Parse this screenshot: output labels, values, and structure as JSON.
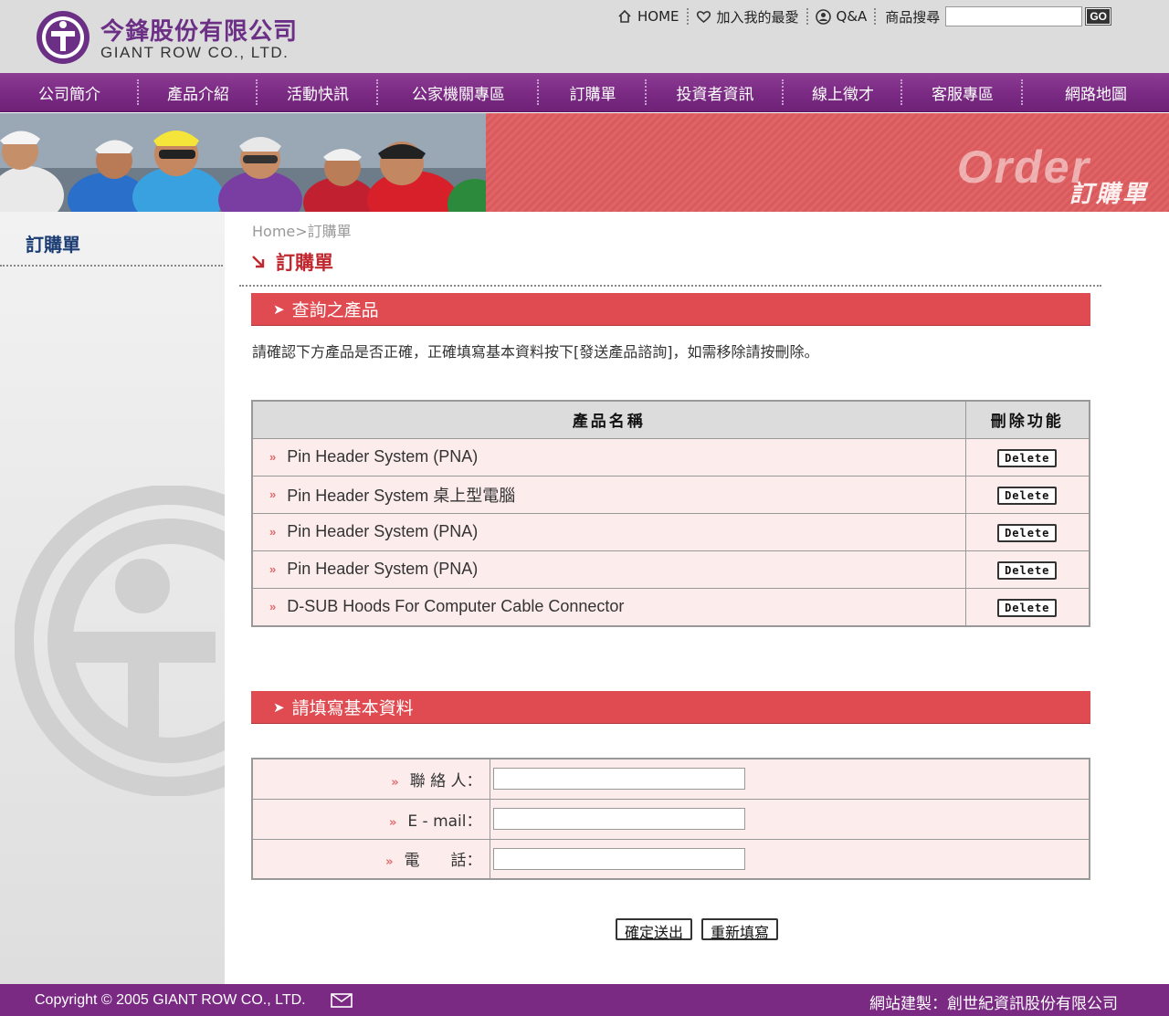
{
  "header": {
    "company_cn": "今鋒股份有限公司",
    "company_en": "GIANT ROW CO., LTD.",
    "links": {
      "home": "HOME",
      "favorite": "加入我的最愛",
      "qa": "Q&A"
    },
    "search": {
      "label": "商品搜尋",
      "value": "",
      "go": "GO"
    }
  },
  "nav": {
    "items": [
      {
        "label": "公司簡介"
      },
      {
        "label": "產品介紹"
      },
      {
        "label": "活動快訊"
      },
      {
        "label": "公家機關專區"
      },
      {
        "label": "訂購單"
      },
      {
        "label": "投資者資訊"
      },
      {
        "label": "線上徵才"
      },
      {
        "label": "客服專區"
      },
      {
        "label": "網路地圖"
      }
    ]
  },
  "banner": {
    "en": "Order",
    "cn": "訂購單"
  },
  "sidebar": {
    "title": "訂購單"
  },
  "main": {
    "breadcrumb": "Home>訂購單",
    "title": "訂購單",
    "products_section": "查詢之產品",
    "instruction": "請確認下方產品是否正確，正確填寫基本資料按下[發送產品諮詢]，如需移除請按刪除。",
    "table": {
      "col_name": "產品名稱",
      "col_delete": "刪除功能",
      "delete_label": "Delete",
      "rows": [
        {
          "name": "Pin Header System (PNA)"
        },
        {
          "name": "Pin Header System 桌上型電腦"
        },
        {
          "name": "Pin Header System (PNA)"
        },
        {
          "name": "Pin Header System (PNA)"
        },
        {
          "name": "D-SUB Hoods For Computer Cable Connector"
        }
      ]
    },
    "form_section": "請填寫基本資料",
    "form": {
      "fields": [
        {
          "label": "聯 絡 人：",
          "value": ""
        },
        {
          "label": "E - mail：",
          "value": ""
        },
        {
          "label": "電　　話：",
          "value": ""
        }
      ],
      "submit": "確定送出",
      "reset": "重新填寫"
    }
  },
  "footer": {
    "copyright": "Copyright © 2005 GIANT ROW CO., LTD.",
    "builder": "網站建製：創世紀資訊股份有限公司"
  },
  "colors": {
    "purple": "#7a2a83",
    "red": "#df4b50",
    "pink_row": "#fdecec"
  }
}
